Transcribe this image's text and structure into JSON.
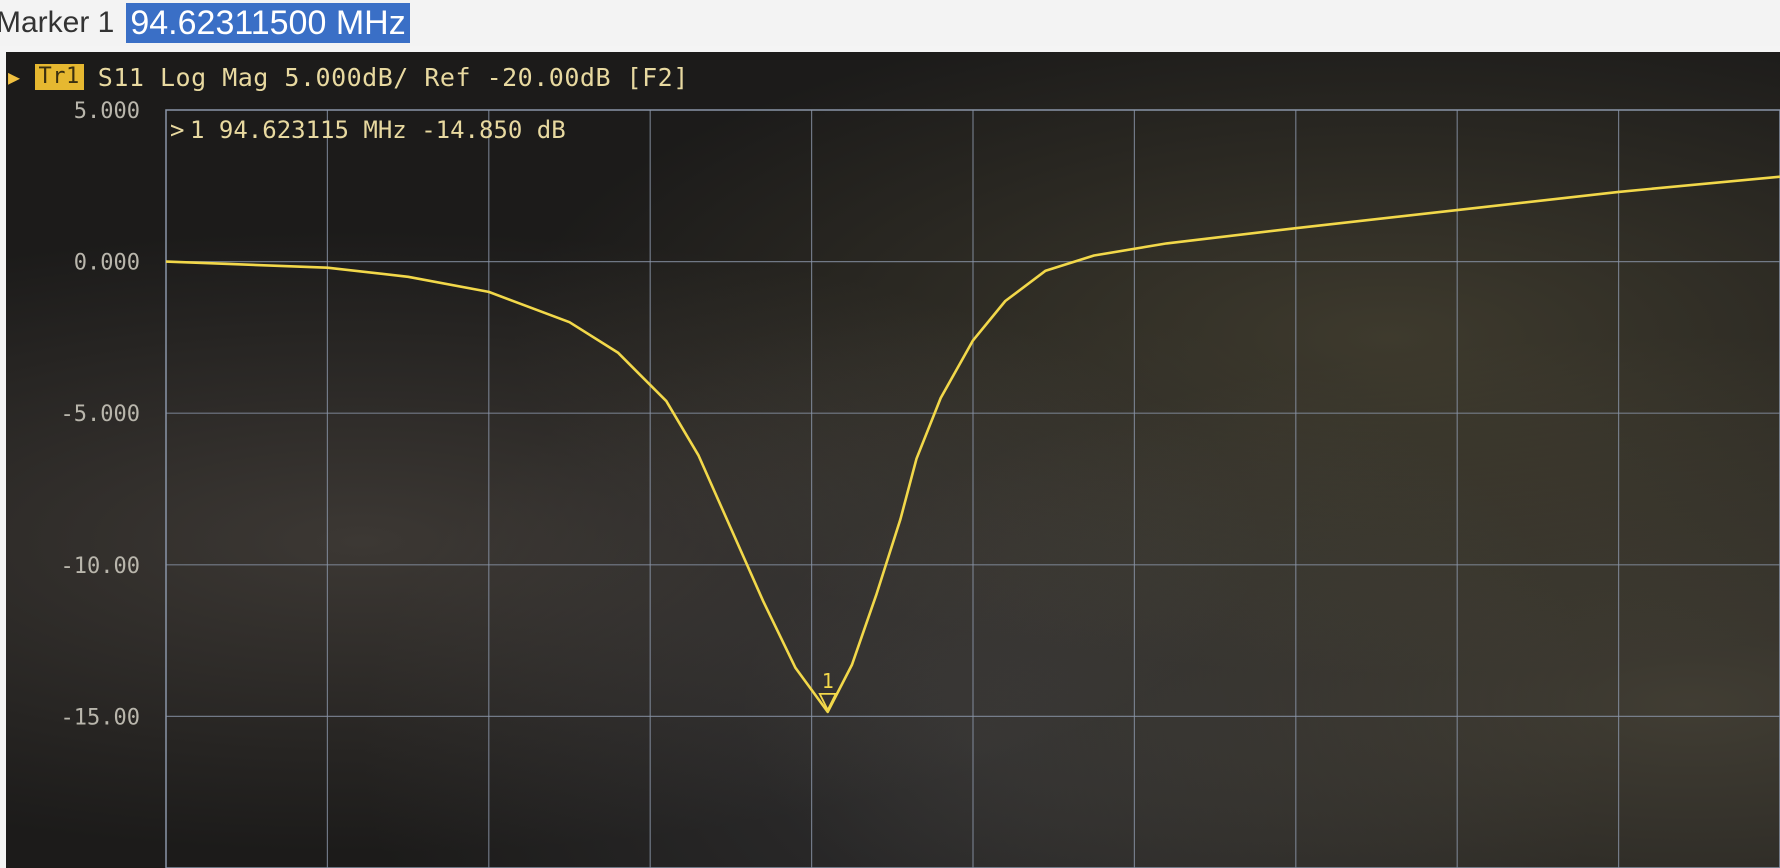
{
  "marker_bar": {
    "label": "Marker 1",
    "value": "94.62311500 MHz"
  },
  "trace_header": {
    "trace_badge": "Tr1",
    "trace_text": "S11 Log Mag 5.000dB/ Ref -20.00dB [F2]"
  },
  "marker_readout": "1  94.623115 MHz -14.850 dB",
  "marker_tag": "1",
  "colors": {
    "trace": "#f2d84a",
    "grid": "#8a95a8",
    "text": "#e8d9a0",
    "background": "#1c1b1a",
    "selection": "#3a6fc6"
  },
  "chart_data": {
    "type": "line",
    "title": "",
    "xlabel": "",
    "ylabel": "",
    "scale_per_div": 5,
    "y_tick_labels": [
      "5.000",
      "0.000",
      "-5.000",
      "-10.00",
      "-15.00"
    ],
    "y_ticks": [
      5,
      0,
      -5,
      -10,
      -15
    ],
    "ylim": [
      -20,
      5
    ],
    "xlim": [
      0,
      10
    ],
    "grid": true,
    "series": [
      {
        "values_x": [
          0,
          1,
          1.5,
          2,
          2.5,
          2.8,
          3.1,
          3.3,
          3.5,
          3.7,
          3.9,
          4.1,
          4.25,
          4.4,
          4.55,
          4.65,
          4.8,
          5.0,
          5.2,
          5.45,
          5.75,
          6.2,
          7,
          8,
          9,
          10
        ],
        "values_y": [
          0.0,
          -0.2,
          -0.5,
          -1.0,
          -2.0,
          -3.0,
          -4.6,
          -6.4,
          -8.8,
          -11.2,
          -13.4,
          -14.85,
          -13.3,
          -11.0,
          -8.5,
          -6.5,
          -4.5,
          -2.6,
          -1.3,
          -0.3,
          0.2,
          0.6,
          1.1,
          1.7,
          2.3,
          2.8
        ]
      }
    ],
    "markers": [
      {
        "id": "1",
        "x": 4.1,
        "y": -14.85
      }
    ]
  }
}
